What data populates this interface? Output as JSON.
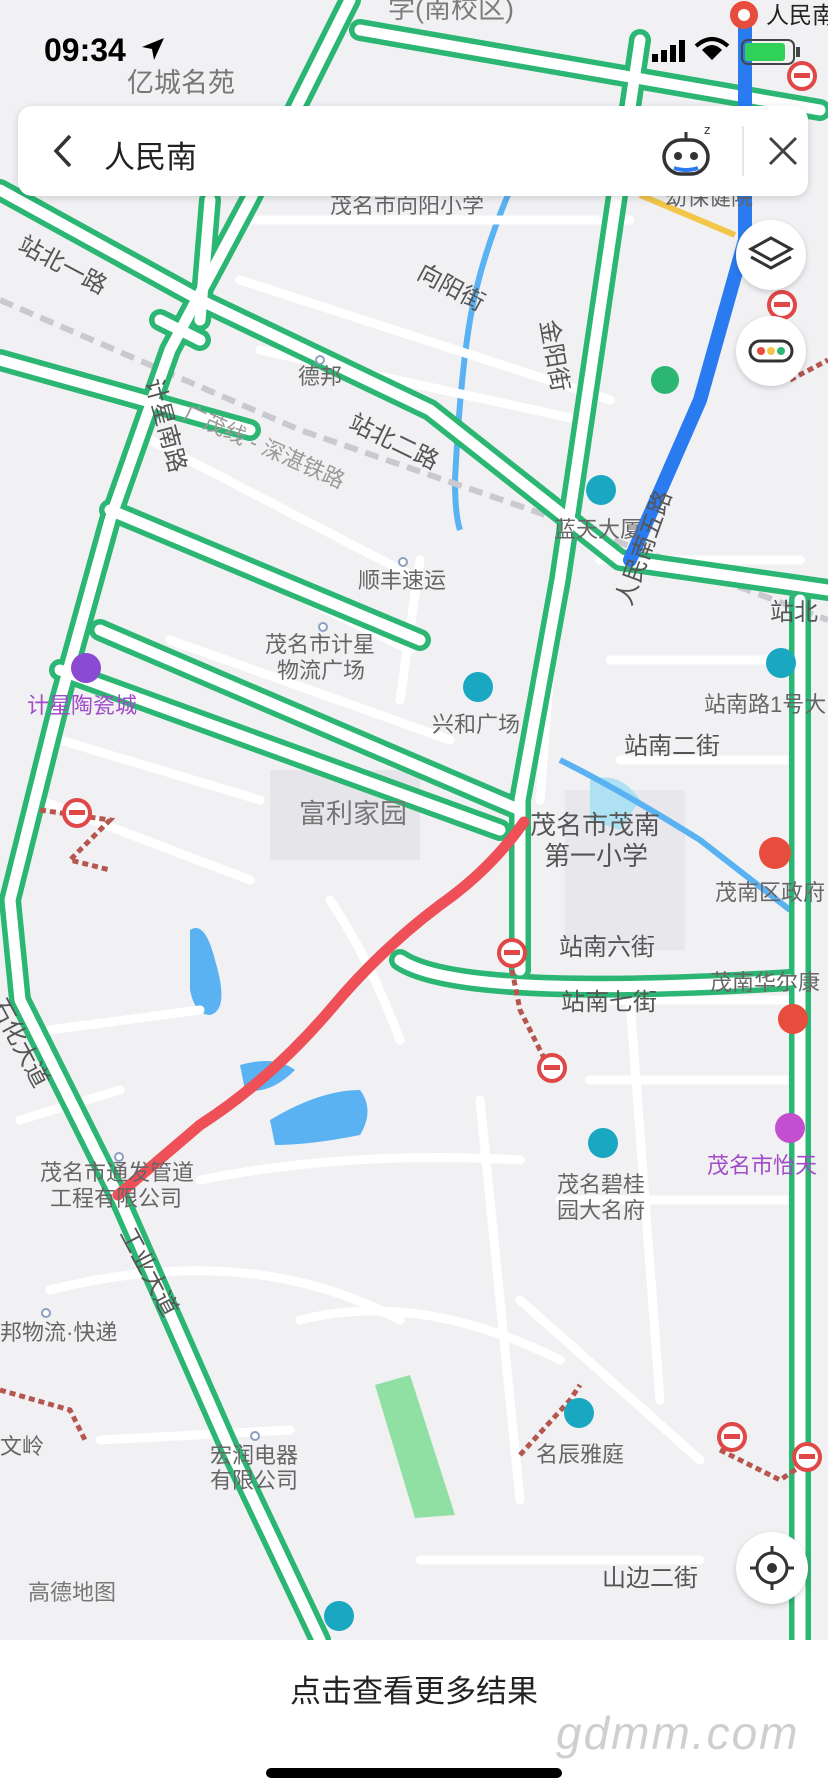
{
  "status_bar": {
    "time": "09:34"
  },
  "search": {
    "query": "人民南"
  },
  "map": {
    "labels": {
      "school_top": "学(南校区)",
      "yicheng": "亿城名苑",
      "xiangyang_school": "茂名市向阳小学",
      "zhanbei1": "站北一路",
      "xiangyang_st": "向阳街",
      "jinyang_st": "金阳街",
      "debang": "德邦",
      "zhanbei2": "站北二路",
      "jixing_south": "计星南路",
      "rail": "广茂线 - 深湛铁路",
      "lantian": "蓝天大厦",
      "shunfeng": "顺丰速运",
      "renmin5": "人民南五路",
      "zhanbei_right": "站北",
      "jixing_logistics_1": "茂名市计星",
      "jixing_logistics_2": "物流广场",
      "xinghe": "兴和广场",
      "zhannan1": "站南路1号大",
      "jixing_ceramic": "计星陶瓷城",
      "zhannan2": "站南二街",
      "fuli": "富利家园",
      "maonan_school_1": "茂名市茂南",
      "maonan_school_2": "第一小学",
      "maonan_gov": "茂南区政府",
      "zhannan6": "站南六街",
      "maonan_huaerkang": "茂南华尔康",
      "zhannan7": "站南七街",
      "shihua": "石化大道",
      "tongda_1": "茂名市通发管道",
      "tongda_2": "工程有限公司",
      "biguiyuan_1": "茂名碧桂",
      "biguiyuan_2": "园大名府",
      "maoming_yi": "茂名市怡天",
      "gongye": "工业大道",
      "wuliu": "邦物流·快递",
      "wenling": "文岭",
      "hongrun_1": "宏润电器",
      "hongrun_2": "有限公司",
      "mingchen": "名辰雅庭",
      "shanbian": "山边二街",
      "amap": "高德地图",
      "renmin_top": "人民南",
      "hospital": "幼保健院"
    }
  },
  "bottom": {
    "more_results": "点击查看更多结果",
    "watermark": "gdmm.com"
  }
}
